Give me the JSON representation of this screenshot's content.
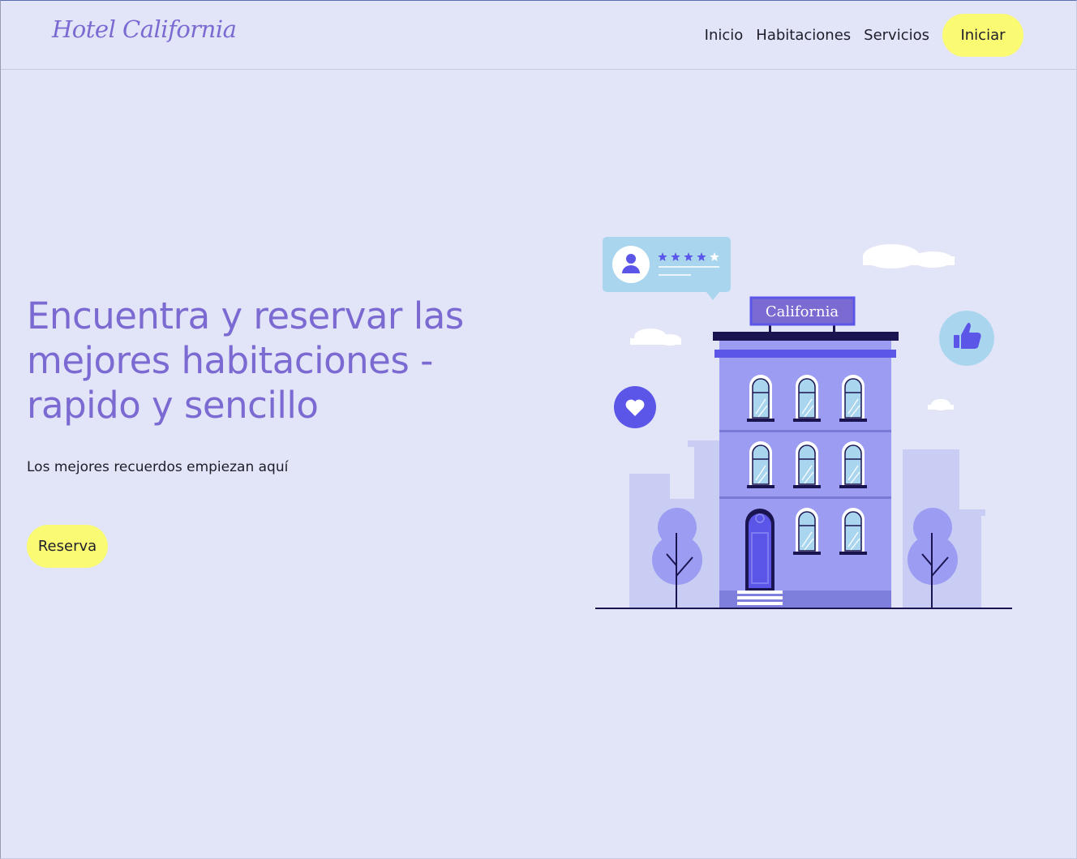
{
  "header": {
    "logo": "Hotel California",
    "nav": [
      "Inicio",
      "Habitaciones",
      "Servicios"
    ],
    "cta_label": "Iniciar"
  },
  "hero": {
    "title": "Encuentra y reservar las mejores habitaciones - rapido y sencillo",
    "subtitle": "Los mejores recuerdos empiezan aquí",
    "button_label": "Reserva"
  },
  "illustration": {
    "sign_text": "California",
    "rating_stars": 4,
    "rating_max": 5,
    "icons": [
      "user-icon",
      "star-icon",
      "heart-icon",
      "thumbs-up-icon"
    ]
  },
  "colors": {
    "background": "#e2e4f8",
    "brand_purple": "#7b6ad2",
    "accent_yellow": "#fafb72",
    "building": "#9c9cf2",
    "deep_indigo": "#5b55e8"
  }
}
